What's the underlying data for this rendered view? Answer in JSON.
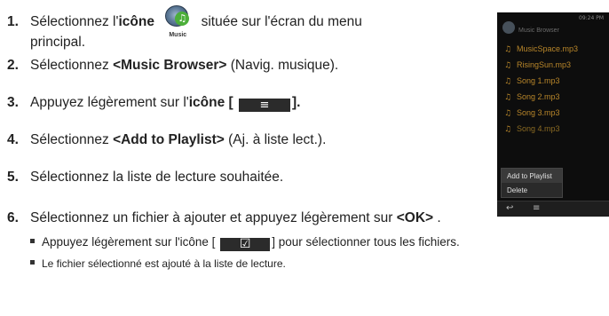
{
  "steps": [
    {
      "num": "1.",
      "pre": "Sélectionnez l'",
      "bold": "icône",
      "post": "située sur l'écran du menu",
      "cont": "principal."
    },
    {
      "num": "2.",
      "pre": "Sélectionnez ",
      "bold": "<Music Browser>",
      "post": " (Navig. musique)."
    },
    {
      "num": "3.",
      "pre": "Appuyez légèrement sur l'",
      "bold": "icône [",
      "post": "]."
    },
    {
      "num": "4.",
      "pre": "Sélectionnez ",
      "bold": "<Add to Playlist>",
      "post": " (Aj. à liste lect.)."
    },
    {
      "num": "5.",
      "pre": "Sélectionnez la liste de lecture souhaitée."
    },
    {
      "num": "6.",
      "pre": "Sélectionnez un fichier à ajouter et appuyez légèrement sur ",
      "bold": "<OK>",
      "post": " ."
    }
  ],
  "bullets": [
    {
      "pre": "Appuyez légèrement sur l'icône [",
      "post": "] pour sélectionner tous les fichiers."
    },
    {
      "text": "Le fichier sélectionné est ajouté à la liste de lecture."
    }
  ],
  "icons": {
    "music_caption": "Music",
    "menu_glyph": "≡",
    "check_glyph": "☑"
  },
  "device": {
    "status": "09:24 PM",
    "title": "Music Browser",
    "files": [
      "MusicSpace.mp3",
      "RisingSun.mp3",
      "Song 1.mp3",
      "Song 2.mp3",
      "Song 3.mp3",
      "Song 4.mp3"
    ],
    "menu": [
      "Add to Playlist",
      "Delete"
    ],
    "back_glyph": "↩",
    "menu_glyph": "≡"
  }
}
